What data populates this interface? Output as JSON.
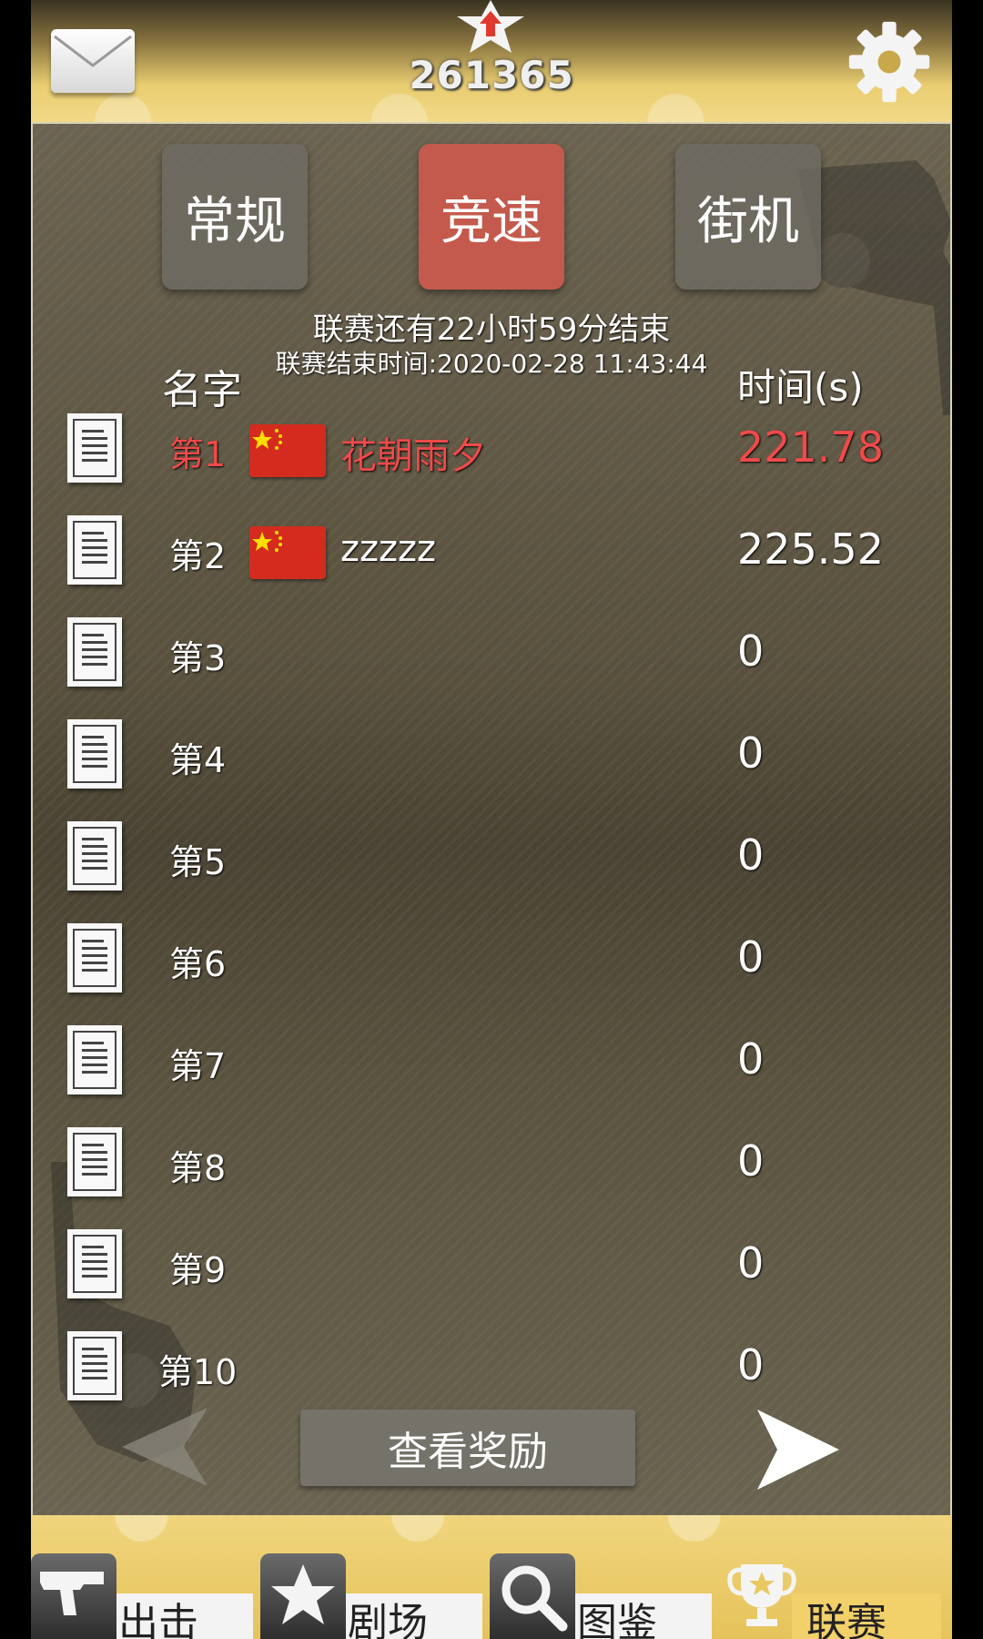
{
  "header": {
    "score": "261365",
    "mail_icon": "mail-icon",
    "settings_icon": "gear-icon",
    "score_icon": "star-up-icon"
  },
  "tabs": [
    {
      "label": "常规",
      "active": false
    },
    {
      "label": "竞速",
      "active": true
    },
    {
      "label": "街机",
      "active": false
    }
  ],
  "league": {
    "countdown": "联赛还有22小时59分结束",
    "end_time": "联赛结束时间:2020-02-28 11:43:44",
    "col_name": "名字",
    "col_time": "时间(s)"
  },
  "rows": [
    {
      "rank": "第1",
      "name": "花朝雨夕",
      "time": "221.78",
      "flag": "china-flag",
      "highlight": true
    },
    {
      "rank": "第2",
      "name": "zzzzz",
      "time": "225.52",
      "flag": "china-flag",
      "highlight": false
    },
    {
      "rank": "第3",
      "name": "",
      "time": "0"
    },
    {
      "rank": "第4",
      "name": "",
      "time": "0"
    },
    {
      "rank": "第5",
      "name": "",
      "time": "0"
    },
    {
      "rank": "第6",
      "name": "",
      "time": "0"
    },
    {
      "rank": "第7",
      "name": "",
      "time": "0"
    },
    {
      "rank": "第8",
      "name": "",
      "time": "0"
    },
    {
      "rank": "第9",
      "name": "",
      "time": "0"
    },
    {
      "rank": "第10",
      "name": "",
      "time": "0"
    }
  ],
  "reward_button": "查看奖励",
  "nav": [
    {
      "label": "出击",
      "icon": "pistol-icon",
      "active": false
    },
    {
      "label": "剧场",
      "icon": "star-icon",
      "active": false
    },
    {
      "label": "图鉴",
      "icon": "search-icon",
      "active": false
    },
    {
      "label": "联赛",
      "icon": "trophy-icon",
      "active": true
    }
  ],
  "colors": {
    "accent_red": "#ef4a4a",
    "active_tab": "#c45a4d",
    "gold": "#e9c85f"
  }
}
